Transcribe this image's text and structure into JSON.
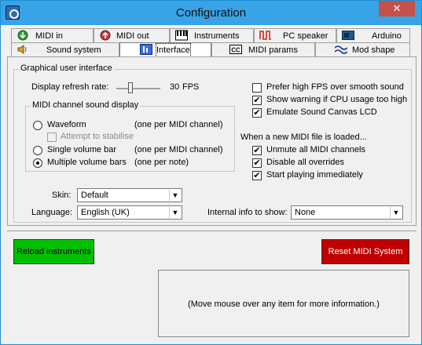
{
  "window": {
    "title": "Configuration",
    "close_glyph": "✕"
  },
  "tabs_row1": [
    {
      "label": "MIDI in",
      "icon": "midi-in-icon"
    },
    {
      "label": "MIDI out",
      "icon": "midi-out-icon"
    },
    {
      "label": "Instruments",
      "icon": "piano-keys-icon"
    },
    {
      "label": "PC speaker",
      "icon": "square-wave-icon"
    },
    {
      "label": "Arduino",
      "icon": "arduino-icon"
    }
  ],
  "tabs_row2": [
    {
      "label": "Sound system",
      "icon": "speaker-icon"
    },
    {
      "label": "Interface",
      "icon": "interface-icon",
      "selected": true
    },
    {
      "label": "MIDI params",
      "icon": "cc-icon"
    },
    {
      "label": "Mod shape",
      "icon": "wave-shape-icon"
    }
  ],
  "gui": {
    "group_label": "Graphical user interface",
    "refresh_label": "Display refresh rate:",
    "refresh_value": "30",
    "refresh_unit": "FPS",
    "refresh_level": 0.3
  },
  "midi_display": {
    "group_label": "MIDI channel sound display",
    "options": [
      {
        "label": "Waveform",
        "note": "(one per MIDI channel)",
        "selected": false
      },
      {
        "label": "Single volume bar",
        "note": "(one per MIDI channel)",
        "selected": false
      },
      {
        "label": "Multiple volume bars",
        "note": "(one per note)",
        "selected": true
      }
    ],
    "stabilise_label": "Attempt to stabilise",
    "stabilise_checked": false
  },
  "right_options": [
    {
      "label": "Prefer high FPS over smooth sound",
      "checked": false
    },
    {
      "label": "Show warning if CPU usage too high",
      "checked": true
    },
    {
      "label": "Emulate Sound Canvas LCD",
      "checked": true
    }
  ],
  "on_load": {
    "heading": "When a new MIDI file is loaded...",
    "options": [
      {
        "label": "Unmute all MIDI channels",
        "checked": true
      },
      {
        "label": "Disable all overrides",
        "checked": true
      },
      {
        "label": "Start playing immediately",
        "checked": true
      }
    ]
  },
  "skin": {
    "label": "Skin:",
    "value": "Default"
  },
  "language": {
    "label": "Language:",
    "value": "English (UK)"
  },
  "internal_info": {
    "label": "Internal info to show:",
    "value": "None"
  },
  "buttons": {
    "reload": "Reload instruments",
    "reset": "Reset MIDI System",
    "reload_color": "#00c000",
    "reset_color": "#c00000"
  },
  "info_text": "(Move mouse over any item for more information.)",
  "check_glyph": "✔",
  "dropdown_glyph": "▼"
}
